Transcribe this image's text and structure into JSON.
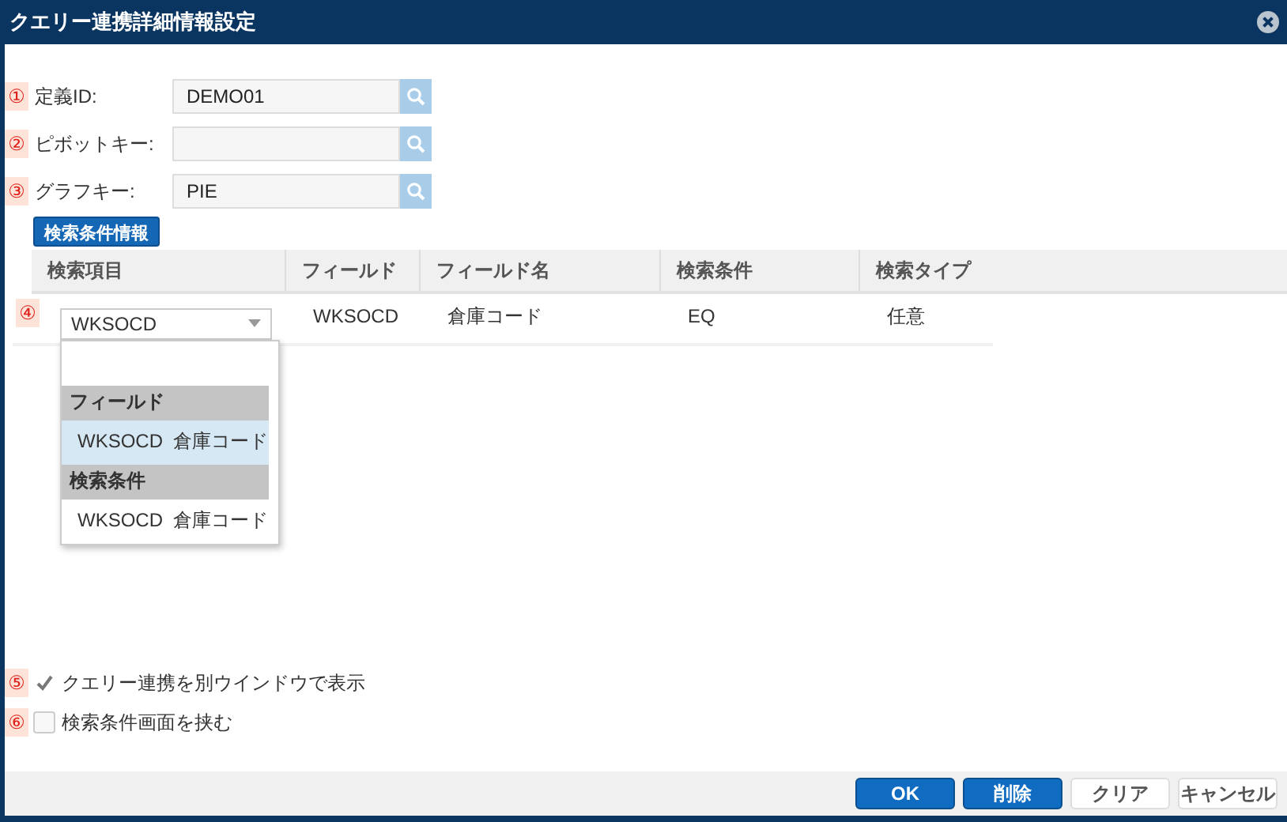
{
  "window": {
    "title": "クエリー連携詳細情報設定"
  },
  "fields": [
    {
      "marker": "①",
      "label": "定義ID:",
      "value": "DEMO01"
    },
    {
      "marker": "②",
      "label": "ピボットキー:"
    },
    {
      "marker": "③",
      "label": "グラフキー:",
      "value": "PIE"
    }
  ],
  "section_button": "検索条件情報",
  "table": {
    "columns": [
      "検索項目",
      "フィールド",
      "フィールド名",
      "検索条件",
      "検索タイプ"
    ],
    "rows": [
      {
        "marker": "④",
        "cells": [
          "WKSOCD",
          "WKSOCD",
          "倉庫コード",
          "EQ",
          "任意"
        ]
      }
    ]
  },
  "dropdown": {
    "items": [
      {
        "kind": "blank"
      },
      {
        "kind": "group",
        "label": "フィールド"
      },
      {
        "kind": "option",
        "code": "WKSOCD",
        "name": "倉庫コード",
        "selected": true
      },
      {
        "kind": "group",
        "label": "検索条件"
      },
      {
        "kind": "option",
        "code": "WKSOCD",
        "name": "倉庫コード",
        "selected": false
      }
    ]
  },
  "checkboxes": [
    {
      "marker": "⑤",
      "label": "クエリー連携を別ウインドウで表示",
      "checked": true
    },
    {
      "marker": "⑥",
      "label": "検索条件画面を挟む",
      "checked": false
    }
  ],
  "buttons": [
    {
      "label": "OK",
      "kind": "primary"
    },
    {
      "label": "削除",
      "kind": "primary"
    },
    {
      "label": "クリア",
      "kind": "secondary"
    },
    {
      "label": "キャンセル",
      "kind": "secondary"
    }
  ]
}
